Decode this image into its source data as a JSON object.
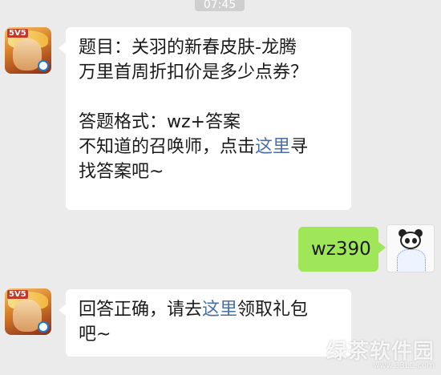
{
  "timestamp": "07:45",
  "messages": [
    {
      "side": "left",
      "sender_avatar": "game-avatar",
      "lines": [
        {
          "text": "题目：关羽的新春皮肤-龙腾"
        },
        {
          "text": "万里首周折扣价是多少点券？"
        },
        {
          "text": ""
        },
        {
          "text": "答题格式：wz+答案"
        },
        {
          "text": "不知道的召唤师，点击",
          "link": "这里",
          "after": "寻"
        },
        {
          "text": "找答案吧~"
        }
      ]
    },
    {
      "side": "right",
      "sender_avatar": "panda-avatar",
      "text": "wz390"
    },
    {
      "side": "left",
      "sender_avatar": "game-avatar",
      "lines": [
        {
          "text": "回答正确，请去",
          "link": "这里",
          "after": "领取礼包"
        },
        {
          "text": "吧~"
        }
      ]
    }
  ],
  "avatar_badge": "5V5",
  "watermark": {
    "main": "绿茶软件园",
    "url": "www.33LC.com"
  },
  "colors": {
    "background": "#ebebeb",
    "sent_bubble": "#9fe658",
    "link": "#4a6fa8"
  }
}
